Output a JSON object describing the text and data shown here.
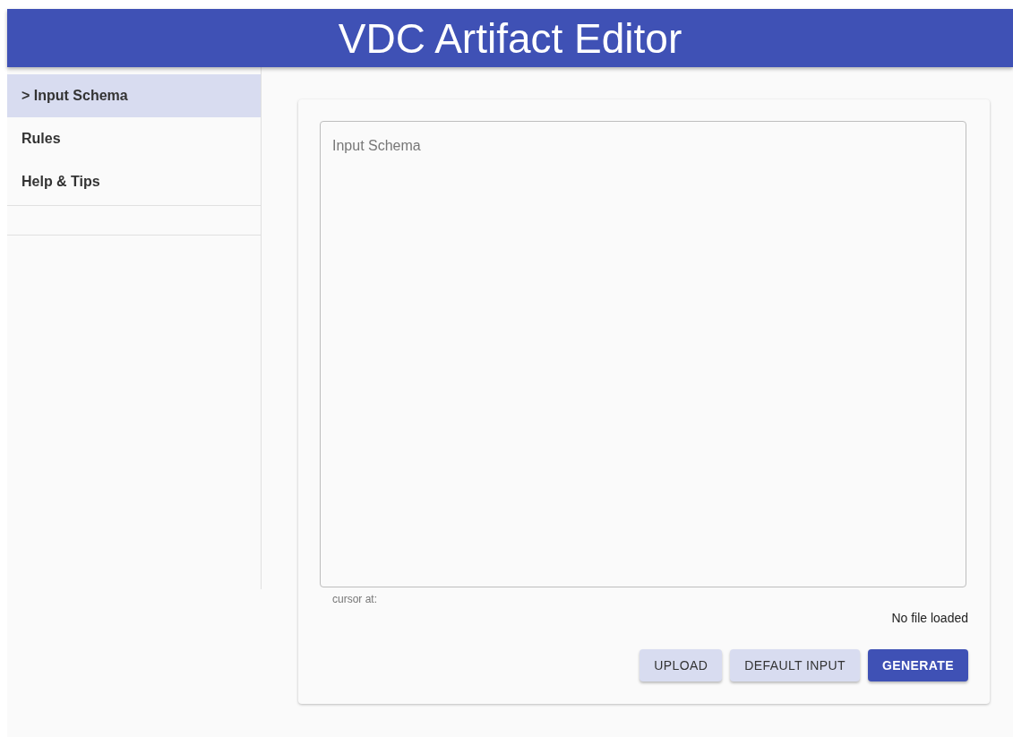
{
  "header": {
    "title": "VDC Artifact Editor"
  },
  "sidebar": {
    "items": [
      {
        "label": "> Input Schema",
        "selected": true
      },
      {
        "label": "Rules",
        "selected": false
      },
      {
        "label": "Help & Tips",
        "selected": false
      }
    ]
  },
  "editor": {
    "placeholder": "Input Schema",
    "cursor_label": "cursor at:",
    "file_status": "No file loaded"
  },
  "buttons": [
    {
      "label": "UPLOAD",
      "kind": "secondary"
    },
    {
      "label": "DEFAULT INPUT",
      "kind": "secondary"
    },
    {
      "label": "GENERATE",
      "kind": "primary"
    }
  ]
}
